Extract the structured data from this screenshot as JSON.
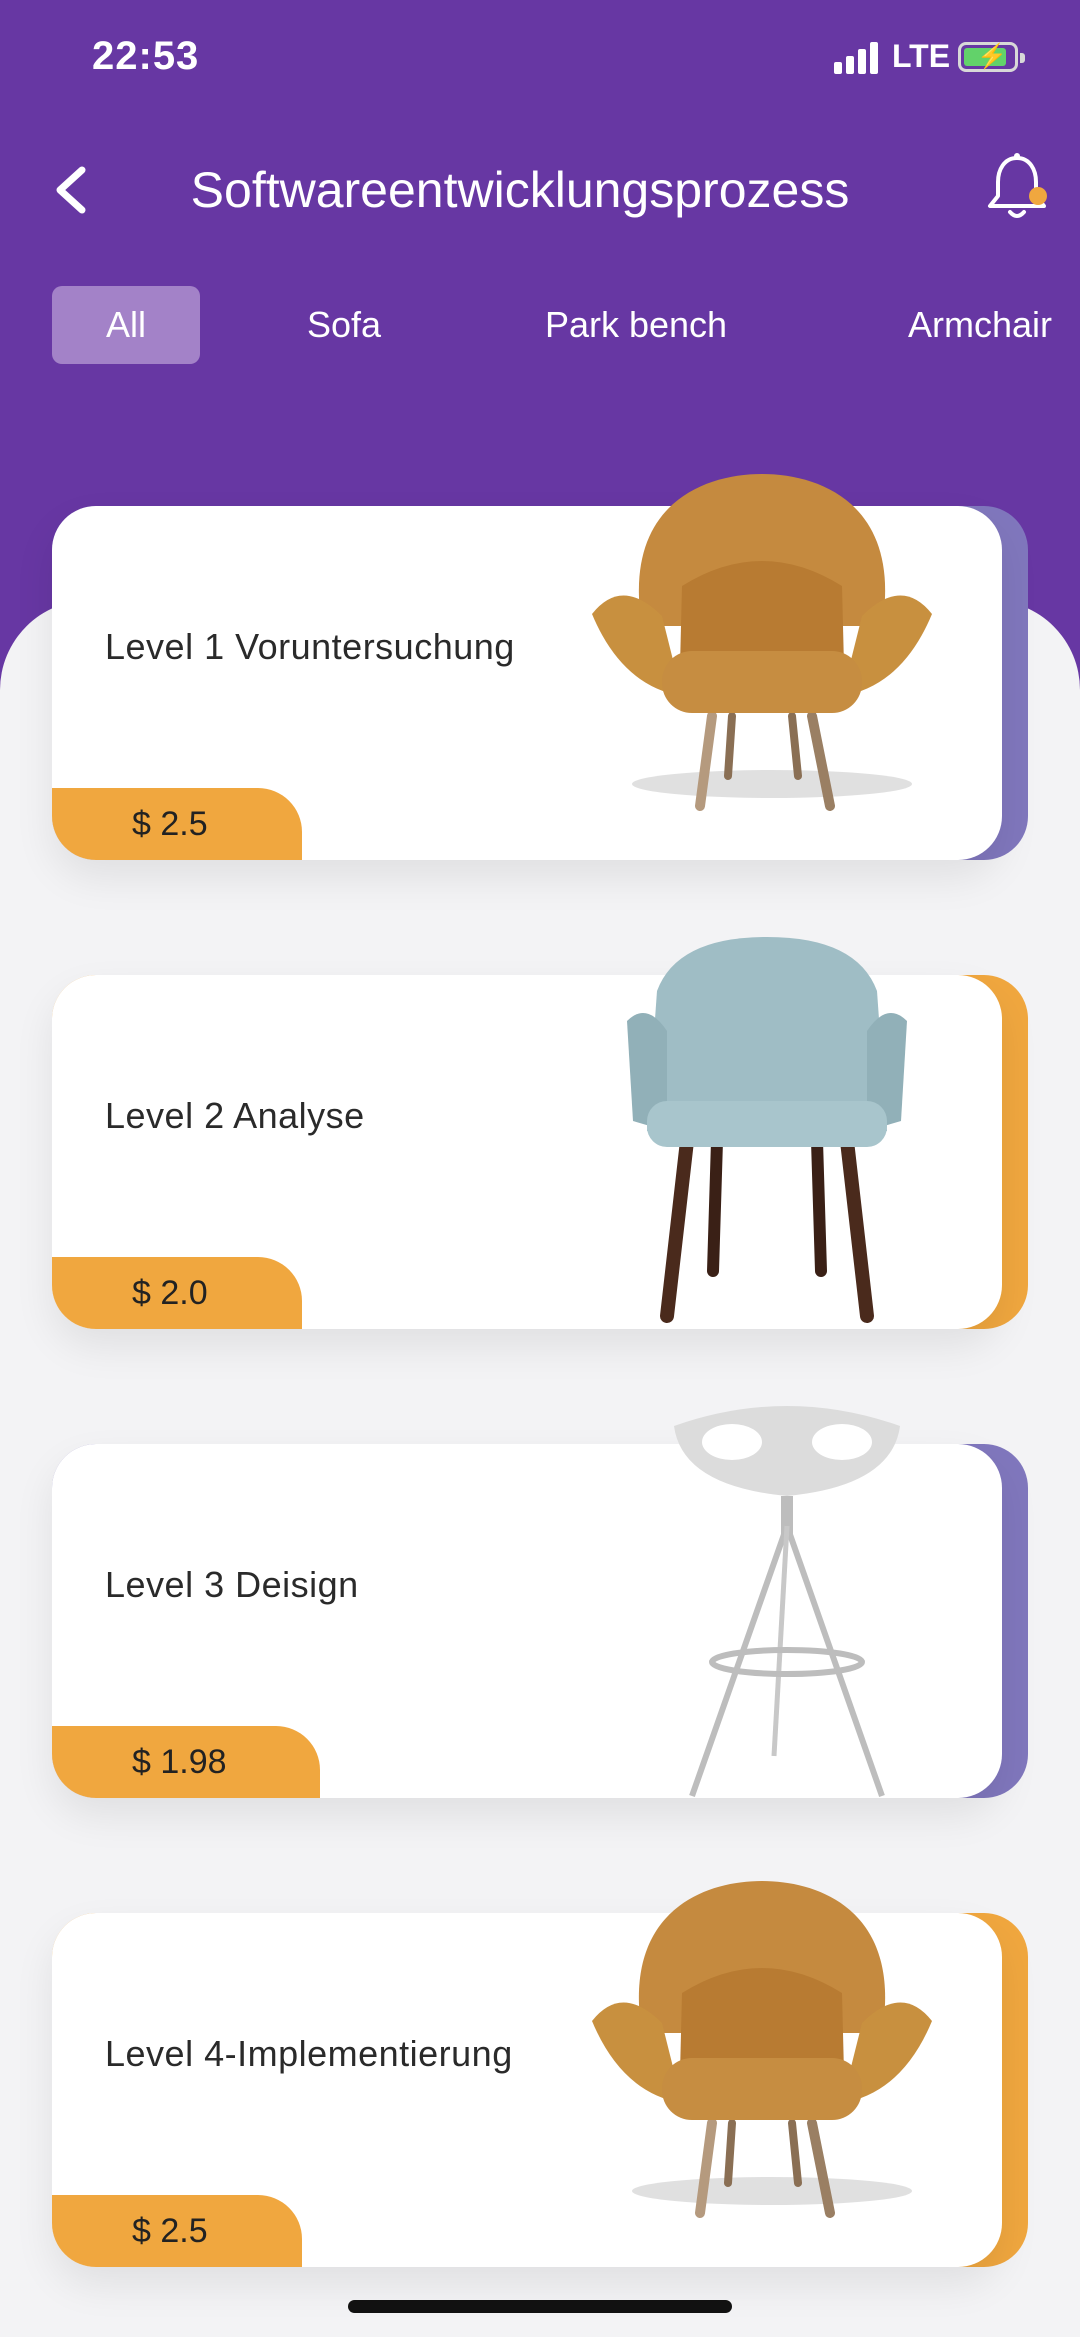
{
  "status_bar": {
    "time": "22:53",
    "network": "LTE"
  },
  "header": {
    "title": "Softwareentwicklungsprozess"
  },
  "tabs": [
    {
      "label": "All",
      "active": true
    },
    {
      "label": "Sofa",
      "active": false
    },
    {
      "label": "Park bench",
      "active": false
    },
    {
      "label": "Armchair",
      "active": false
    }
  ],
  "cards": [
    {
      "title": "Level 1 Voruntersuchung",
      "price": "$ 2.5",
      "accent": "#8077bd",
      "image": "mustard-armchair"
    },
    {
      "title": "Level 2 Analyse",
      "price": "$ 2.0",
      "accent": "#f0a73f",
      "image": "blue-dining-chair"
    },
    {
      "title": "Level 3 Deisign",
      "price": "$ 1.98",
      "accent": "#8077bd",
      "image": "white-bar-stool"
    },
    {
      "title": "Level 4-Implementierung",
      "price": "$ 2.5",
      "accent": "#f0a73f",
      "image": "mustard-armchair"
    }
  ],
  "colors": {
    "header": "#6737a3",
    "active_tab": "#a382c8",
    "price_tag": "#f0a73f",
    "notification_dot": "#f0a73f"
  }
}
